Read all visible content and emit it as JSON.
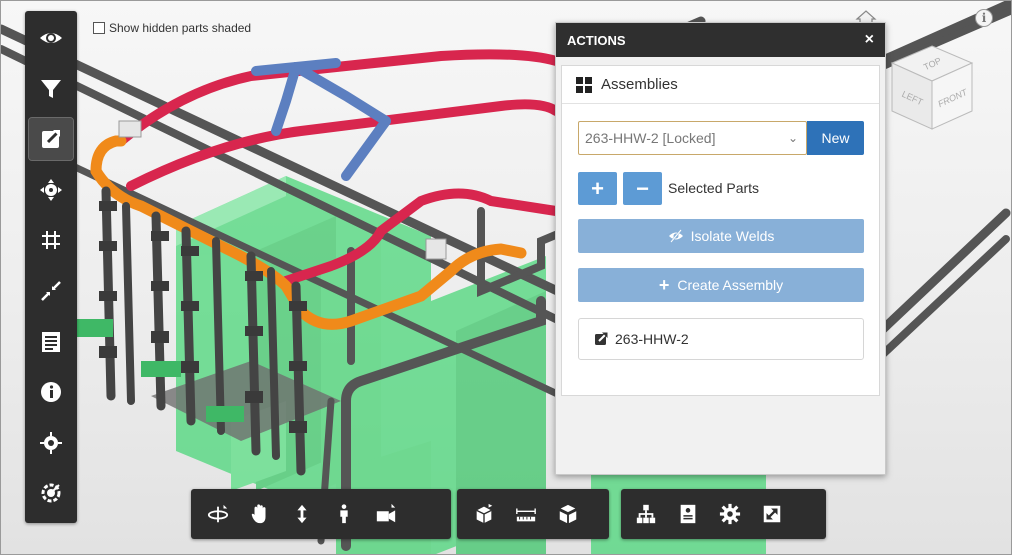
{
  "viewer": {
    "hidden_parts_label": "Show hidden parts shaded"
  },
  "left_toolbar": [
    {
      "icon": "eye-icon"
    },
    {
      "icon": "filter-icon"
    },
    {
      "icon": "edit-external-icon",
      "active": true
    },
    {
      "icon": "explode-icon"
    },
    {
      "icon": "grid-icon"
    },
    {
      "icon": "collapse-icon"
    },
    {
      "icon": "list-icon"
    },
    {
      "icon": "info-icon"
    },
    {
      "icon": "target-icon"
    },
    {
      "icon": "settings-target-icon"
    }
  ],
  "bottom_toolbar": {
    "navigation": [
      "orbit-icon",
      "pan-icon",
      "zoom-icon",
      "first-person-icon",
      "camera-icon"
    ],
    "tools": [
      "section-icon",
      "measure-icon",
      "explode-cube-icon"
    ],
    "panels": [
      "model-tree-icon",
      "properties-icon",
      "settings-icon",
      "fullscreen-icon"
    ]
  },
  "actions_panel": {
    "title": "ACTIONS",
    "close_glyph": "×",
    "section_title": "Assemblies",
    "assembly_select": "263-HHW-2 [Locked]",
    "new_label": "New",
    "add_glyph": "+",
    "remove_glyph": "−",
    "selected_parts_label": "Selected Parts",
    "isolate_welds_label": "Isolate Welds",
    "create_assembly_label": "Create Assembly",
    "assembly_item_label": "263-HHW-2"
  },
  "view_cube": {
    "top": "TOP",
    "left": "LEFT",
    "front": "FRONT"
  },
  "info_glyph": "i",
  "colors": {
    "pipe_gray": "#5a5a5a",
    "pipe_red": "#d8264e",
    "pipe_orange": "#f08a1a",
    "pipe_blue": "#5c7fc0",
    "equipment_green": "#4cd77a",
    "primary_button": "#2e72b8",
    "light_button": "#88b0d8"
  }
}
